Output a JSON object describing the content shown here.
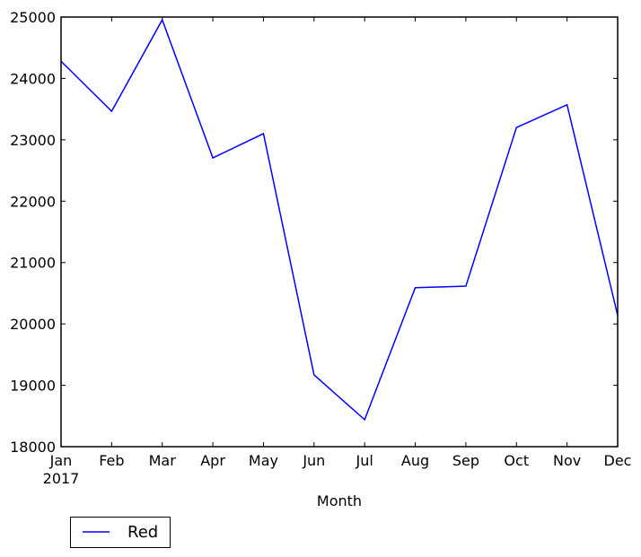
{
  "chart_data": {
    "type": "line",
    "title": "",
    "xlabel": "Month",
    "ylabel": "",
    "categories": [
      "Jan",
      "Feb",
      "Mar",
      "Apr",
      "May",
      "Jun",
      "Jul",
      "Aug",
      "Sep",
      "Oct",
      "Nov",
      "Dec"
    ],
    "x_sublabel": "2017",
    "series": [
      {
        "name": "Red",
        "color": "#0000ff",
        "values": [
          24280,
          23465,
          24955,
          22705,
          23100,
          19170,
          18440,
          20590,
          20615,
          23200,
          23570,
          20140
        ]
      }
    ],
    "ylim": [
      18000,
      25000
    ],
    "yticks": [
      18000,
      19000,
      20000,
      21000,
      22000,
      23000,
      24000,
      25000
    ],
    "grid": false,
    "legend_position": "below-left"
  }
}
